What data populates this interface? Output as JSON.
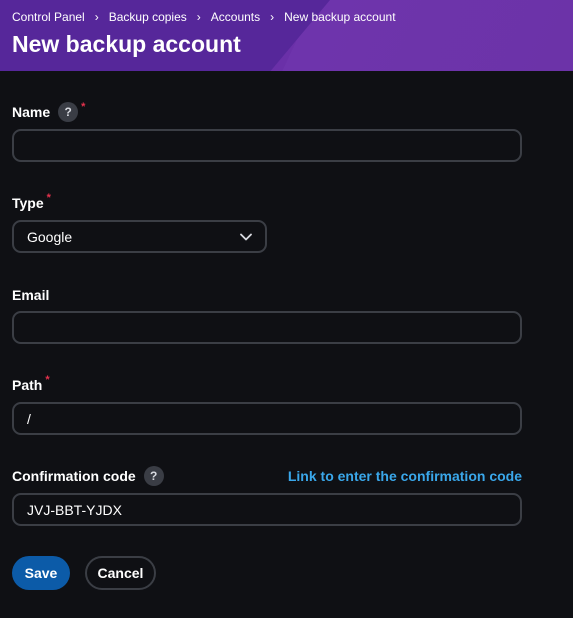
{
  "breadcrumb": [
    "Control Panel",
    "Backup copies",
    "Accounts",
    "New backup account"
  ],
  "page_title": "New backup account",
  "form": {
    "name": {
      "label": "Name",
      "required_mark": "*",
      "help": "?",
      "value": ""
    },
    "type": {
      "label": "Type",
      "required_mark": "*",
      "value": "Google"
    },
    "email": {
      "label": "Email",
      "value": ""
    },
    "path": {
      "label": "Path",
      "required_mark": "*",
      "value": "/"
    },
    "confirmation": {
      "label": "Confirmation code",
      "help": "?",
      "link": "Link to enter the confirmation code",
      "value": "JVJ-BBT-YJDX"
    }
  },
  "buttons": {
    "save": "Save",
    "cancel": "Cancel"
  },
  "colors": {
    "background": "#0f1014",
    "header": "#6a30a8",
    "accent_link": "#3aa7ea",
    "primary_button": "#0c5ba8",
    "required": "#e5324d"
  }
}
